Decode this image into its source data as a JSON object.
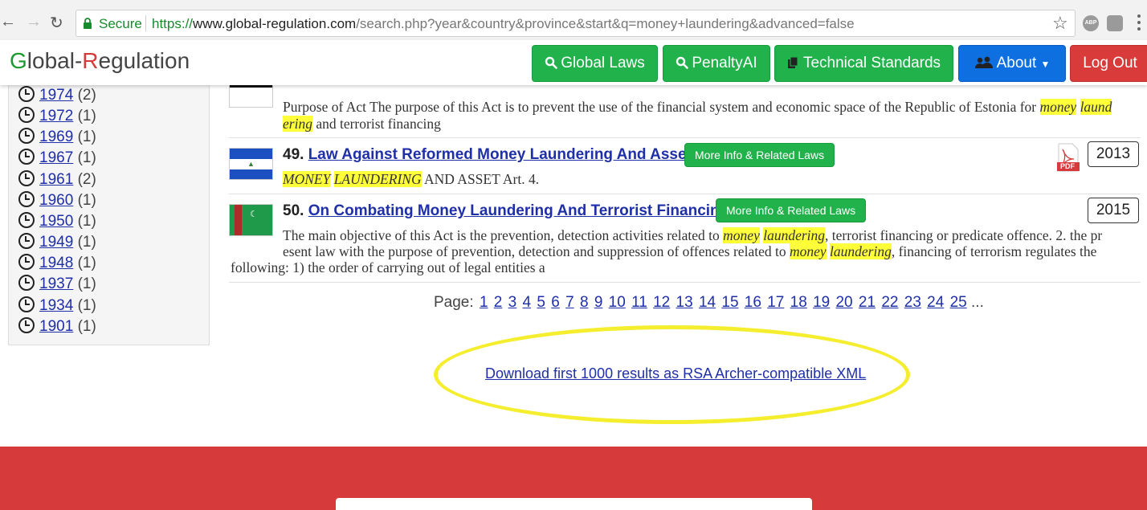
{
  "browser": {
    "secure_label": "Secure",
    "url_scheme": "https://",
    "url_host": "www.global-regulation.com",
    "url_path": "/search.php?year&country&province&start&q=money+laundering&advanced=false"
  },
  "header": {
    "logo_g": "G",
    "logo_1": "lobal-",
    "logo_r": "R",
    "logo_2": "egulation",
    "nav": {
      "global_laws": "Global Laws",
      "penalty_ai": "PenaltyAI",
      "technical_standards": "Technical Standards",
      "about": "About",
      "logout": "Log Out"
    }
  },
  "sidebar": {
    "years": [
      {
        "year": "1974",
        "count": "(2)"
      },
      {
        "year": "1972",
        "count": "(1)"
      },
      {
        "year": "1969",
        "count": "(1)"
      },
      {
        "year": "1967",
        "count": "(1)"
      },
      {
        "year": "1961",
        "count": "(2)"
      },
      {
        "year": "1960",
        "count": "(1)"
      },
      {
        "year": "1950",
        "count": "(1)"
      },
      {
        "year": "1949",
        "count": "(1)"
      },
      {
        "year": "1948",
        "count": "(1)"
      },
      {
        "year": "1937",
        "count": "(1)"
      },
      {
        "year": "1934",
        "count": "(1)"
      },
      {
        "year": "1901",
        "count": "(1)"
      }
    ]
  },
  "results": {
    "r48": {
      "snippet_1": "Purpose of Act The purpose of this Act is to prevent the use of the financial system and economic space of the Republic of Estonia for ",
      "hl_1": "money",
      "hl_2": "laund",
      "hl_3": "ering",
      "snippet_2": " and terrorist financing"
    },
    "r49": {
      "number": "49.",
      "title": "Law Against Reformed Money Laundering And Asset.",
      "more": "More Info & Related Laws",
      "pdf": "PDF",
      "year": "2013",
      "hl_1": "MONEY",
      "hl_2": "LAUNDERING",
      "snippet": " AND ASSET Art. 4."
    },
    "r50": {
      "number": "50.",
      "title": "On Combating Money Laundering And Terrorist Financing",
      "more": "More Info & Related Laws",
      "year": "2015",
      "s1": "The main objective of this Act is the prevention, detection activities related to ",
      "hl_1": "money",
      "hl_2": "laundering",
      "s2": ", terrorist financing or predicate offence. 2. the pr",
      "s3": "esent law with the purpose of prevention, detection and suppression of offences related to ",
      "hl_3": "money",
      "hl_4": "laundering",
      "s4": ", financing of terrorism regulates the",
      "s5": "following: 1) the order of carrying out of legal entities a"
    }
  },
  "pagination": {
    "label": "Page:",
    "pages": [
      "1",
      "2",
      "3",
      "4",
      "5",
      "6",
      "7",
      "8",
      "9",
      "10",
      "11",
      "12",
      "13",
      "14",
      "15",
      "16",
      "17",
      "18",
      "19",
      "20",
      "21",
      "22",
      "23",
      "24",
      "25"
    ],
    "ellipsis": "..."
  },
  "download": {
    "label": "Download first 1000 results as RSA Archer-compatible XML"
  },
  "colors": {
    "green": "#22b24c",
    "blue": "#0d6fe0",
    "red": "#d63a3a",
    "highlight": "#ffff3a",
    "link": "#1f2fa8"
  }
}
